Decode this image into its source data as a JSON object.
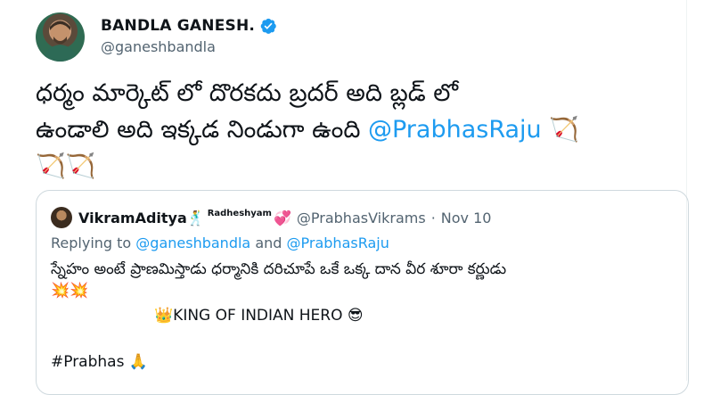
{
  "author": {
    "display_name": "BANDLA GANESH.",
    "handle": "@ganeshbandla",
    "verified": true,
    "avatar_icon": "profile-photo"
  },
  "tweet": {
    "line1": "ధర్మం మార్కెట్ లో దొరకదు బ్రదర్ అది బ్లడ్ లో",
    "line2": "ఉండాలి  అది ఇక్కడ నిండుగా ఉంది ",
    "mention": "@PrabhasRaju",
    "emoji_trailing": "🏹",
    "emoji_line3": "🏹🏹"
  },
  "quote": {
    "name": "VikramAditya",
    "name_emoji": "🕺",
    "name_decor": "Radheshyam",
    "name_heart": "💞",
    "handle": "@PrabhasVikrams",
    "separator": "·",
    "date": "Nov 10",
    "replying_prefix": "Replying to ",
    "replying_user1": "@ganeshbandla",
    "replying_and": " and ",
    "replying_user2": "@PrabhasRaju",
    "body_line1": "స్నేహం అంటే ప్రాణమిస్తాడు ధర్మానికి దరిచూపే ఒకే ఒక్క దాన వీర శూరా కర్ణుడు",
    "body_emoji": "💥💥",
    "center_crown": "👑",
    "center_text": "KING OF INDIAN HERO ",
    "center_emoji": "😎",
    "hashtag": "#Prabhas ",
    "hashtag_emoji": "🙏"
  },
  "colors": {
    "link": "#1d9bf0",
    "secondary_text": "#536471",
    "border": "#cfd9de"
  }
}
